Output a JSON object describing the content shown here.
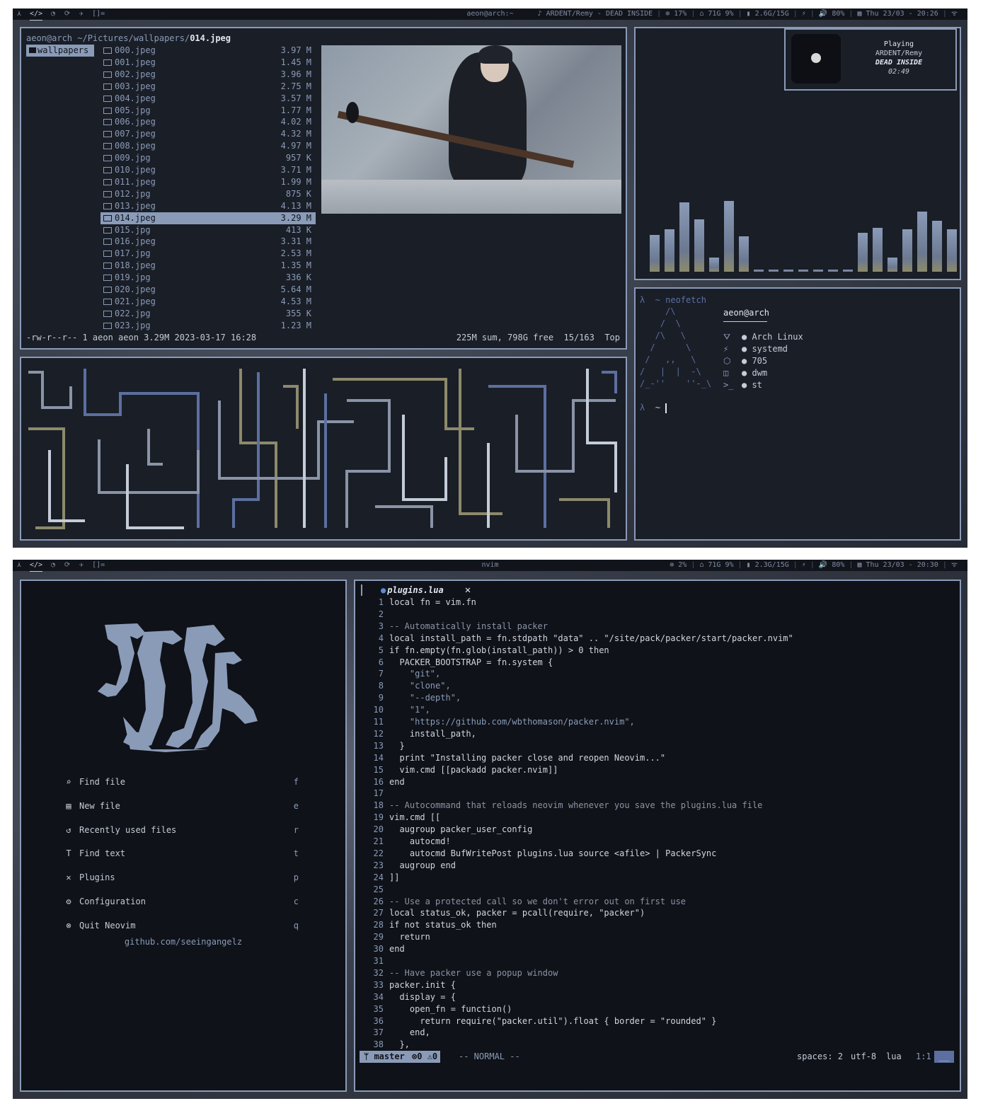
{
  "screen1": {
    "bar": {
      "tags": [
        "⋏",
        "</>",
        "◔",
        "⟳",
        "✈",
        "[]="
      ],
      "title": "aeon@arch:~",
      "status": [
        "♪ ARDENT/Remy - DEAD INSIDE",
        "⊕ 17%",
        "⌂ 71G 9%",
        "▮ 2.6G/15G",
        "⚡",
        "🔊 80%",
        "▦ Thu 23/03 - 20:26",
        "ᯤ"
      ]
    },
    "filemanager": {
      "prompt_user": "aeon@arch",
      "prompt_path": " ~/Pictures/wallpapers/",
      "prompt_file": "014.jpeg",
      "dir": "wallpapers",
      "files": [
        {
          "name": "000.jpeg",
          "size": "3.97 M"
        },
        {
          "name": "001.jpeg",
          "size": "1.45 M"
        },
        {
          "name": "002.jpeg",
          "size": "3.96 M"
        },
        {
          "name": "003.jpeg",
          "size": "2.75 M"
        },
        {
          "name": "004.jpeg",
          "size": "3.57 M"
        },
        {
          "name": "005.jpg",
          "size": "1.77 M"
        },
        {
          "name": "006.jpeg",
          "size": "4.02 M"
        },
        {
          "name": "007.jpeg",
          "size": "4.32 M"
        },
        {
          "name": "008.jpeg",
          "size": "4.97 M"
        },
        {
          "name": "009.jpg",
          "size": "957 K"
        },
        {
          "name": "010.jpeg",
          "size": "3.71 M"
        },
        {
          "name": "011.jpeg",
          "size": "1.99 M"
        },
        {
          "name": "012.jpg",
          "size": "875 K"
        },
        {
          "name": "013.jpeg",
          "size": "4.13 M"
        },
        {
          "name": "014.jpeg",
          "size": "3.29 M"
        },
        {
          "name": "015.jpg",
          "size": "413 K"
        },
        {
          "name": "016.jpeg",
          "size": "3.31 M"
        },
        {
          "name": "017.jpg",
          "size": "2.53 M"
        },
        {
          "name": "018.jpeg",
          "size": "1.35 M"
        },
        {
          "name": "019.jpg",
          "size": "336 K"
        },
        {
          "name": "020.jpeg",
          "size": "5.64 M"
        },
        {
          "name": "021.jpeg",
          "size": "4.53 M"
        },
        {
          "name": "022.jpg",
          "size": "355 K"
        },
        {
          "name": "023.jpg",
          "size": "1.23 M"
        }
      ],
      "selected_index": 14,
      "footer_left": "-rw-r--r-- 1 aeon aeon 3.29M 2023-03-17 16:28",
      "footer_right": "225M sum, 798G free  15/163  Top"
    },
    "player": {
      "state": "Playing",
      "artist": "ARDENT/Remy",
      "title": "DEAD INSIDE",
      "time": "02:49"
    },
    "visualizer": [
      0.52,
      0.6,
      0.98,
      0.74,
      0.2,
      1.0,
      0.5,
      0.03,
      0.03,
      0.03,
      0.03,
      0.03,
      0.03,
      0.03,
      0.55,
      0.62,
      0.2,
      0.6,
      0.85,
      0.72,
      0.6
    ],
    "neofetch": {
      "cmd": "neofetch",
      "user": "aeon@arch",
      "art": [
        "     /\\",
        "    /  \\",
        "   /\\   \\",
        "  /      \\",
        " /   ,,   \\",
        "/   |  |  -\\",
        "/_-''    ''-_\\"
      ],
      "rows": [
        {
          "icon": "⛛",
          "value": "● Arch Linux"
        },
        {
          "icon": "⚡",
          "value": "● systemd"
        },
        {
          "icon": "⬡",
          "value": "● 705"
        },
        {
          "icon": "◫",
          "value": "● dwm"
        },
        {
          "icon": ">_",
          "value": "● st"
        }
      ],
      "prompt": "~"
    }
  },
  "screen2": {
    "bar": {
      "tags": [
        "⋏",
        "</>",
        "◔",
        "⟳",
        "✈",
        "[]="
      ],
      "title": "nvim",
      "status": [
        "⊕ 2%",
        "⌂ 71G 9%",
        "▮ 2.3G/15G",
        "⚡",
        "🔊 80%",
        "▦ Thu 23/03 - 20:30",
        "ᯤ"
      ]
    },
    "dashboard": {
      "items": [
        {
          "icon": "⌕",
          "label": "Find file",
          "key": "f"
        },
        {
          "icon": "▤",
          "label": "New file",
          "key": "e"
        },
        {
          "icon": "↺",
          "label": "Recently used files",
          "key": "r"
        },
        {
          "icon": "T",
          "label": "Find text",
          "key": "t"
        },
        {
          "icon": "✕",
          "label": "Plugins",
          "key": "p"
        },
        {
          "icon": "⚙",
          "label": "Configuration",
          "key": "c"
        },
        {
          "icon": "⊗",
          "label": "Quit Neovim",
          "key": "q"
        }
      ],
      "footer": "github.com/seeingangelz"
    },
    "editor": {
      "tab": "plugins.lua",
      "lines": [
        "local fn = vim.fn",
        "",
        "-- Automatically install packer",
        "local install_path = fn.stdpath \"data\" .. \"/site/pack/packer/start/packer.nvim\"",
        "if fn.empty(fn.glob(install_path)) > 0 then",
        "  PACKER_BOOTSTRAP = fn.system {",
        "    \"git\",",
        "    \"clone\",",
        "    \"--depth\",",
        "    \"1\",",
        "    \"https://github.com/wbthomason/packer.nvim\",",
        "    install_path,",
        "  }",
        "  print \"Installing packer close and reopen Neovim...\"",
        "  vim.cmd [[packadd packer.nvim]]",
        "end",
        "",
        "-- Autocommand that reloads neovim whenever you save the plugins.lua file",
        "vim.cmd [[",
        "  augroup packer_user_config",
        "    autocmd!",
        "    autocmd BufWritePost plugins.lua source <afile> | PackerSync",
        "  augroup end",
        "]]",
        "",
        "-- Use a protected call so we don't error out on first use",
        "local status_ok, packer = pcall(require, \"packer\")",
        "if not status_ok then",
        "  return",
        "end",
        "",
        "-- Have packer use a popup window",
        "packer.init {",
        "  display = {",
        "    open_fn = function()",
        "      return require(\"packer.util\").float { border = \"rounded\" }",
        "    end,",
        "  },"
      ],
      "status": {
        "branch": "master",
        "errors": "⊗0",
        "warnings": "⚠0",
        "mode": "-- NORMAL --",
        "spaces": "spaces: 2",
        "enc": "utf-8",
        "ft": "lua",
        "pos": "1:1"
      }
    }
  }
}
